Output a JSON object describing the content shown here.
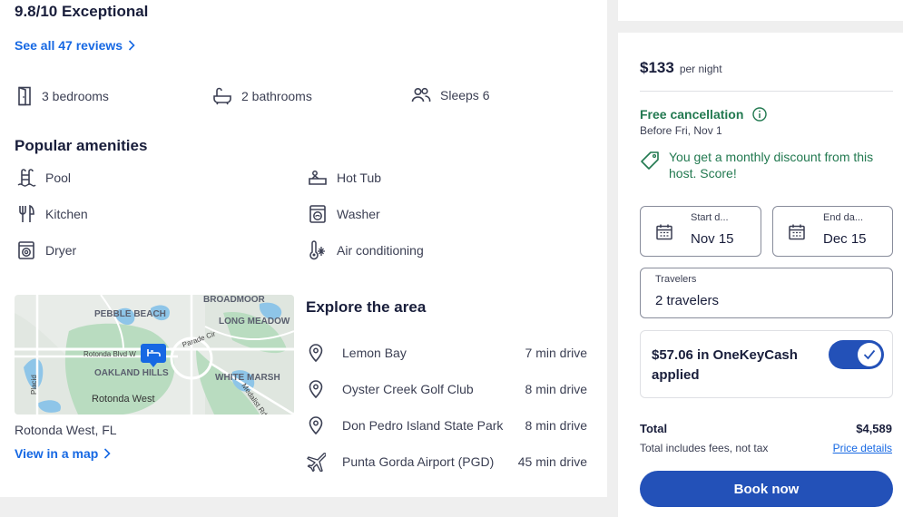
{
  "rating": {
    "text": "9.8/10 Exceptional",
    "reviews_link": "See all 47 reviews"
  },
  "facts": [
    {
      "icon": "door-icon",
      "label": "3 bedrooms"
    },
    {
      "icon": "bathtub-icon",
      "label": "2 bathrooms"
    },
    {
      "icon": "people-icon",
      "label": "Sleeps 6"
    }
  ],
  "amenities": {
    "title": "Popular amenities",
    "items": [
      {
        "icon": "pool-icon",
        "label": "Pool"
      },
      {
        "icon": "hot-tub-icon",
        "label": "Hot Tub"
      },
      {
        "icon": "kitchen-icon",
        "label": "Kitchen"
      },
      {
        "icon": "washer-icon",
        "label": "Washer"
      },
      {
        "icon": "dryer-icon",
        "label": "Dryer"
      },
      {
        "icon": "air-conditioning-icon",
        "label": "Air conditioning"
      }
    ]
  },
  "map": {
    "labels": [
      "BROADMOOR",
      "PEBBLE BEACH",
      "LONG MEADOW",
      "Rotonda Blvd W",
      "Parade Cir",
      "OAKLAND HILLS",
      "WHITE MARSH",
      "Rotonda West",
      "Medalist Rd",
      "Placid"
    ],
    "location": "Rotonda West, FL",
    "view_link": "View in a map"
  },
  "explore": {
    "title": "Explore the area",
    "items": [
      {
        "icon": "location-pin-icon",
        "name": "Lemon Bay",
        "distance": "7 min drive"
      },
      {
        "icon": "location-pin-icon",
        "name": "Oyster Creek Golf Club",
        "distance": "8 min drive"
      },
      {
        "icon": "location-pin-icon",
        "name": "Don Pedro Island State Park",
        "distance": "8 min drive"
      },
      {
        "icon": "airplane-icon",
        "name": "Punta Gorda Airport (PGD)",
        "distance": "45 min drive"
      }
    ]
  },
  "booking": {
    "price": "$133",
    "price_unit": "per night",
    "free_cancellation": "Free cancellation",
    "before_date": "Before Fri, Nov 1",
    "discount_text": "You get a monthly discount from this host. Score!",
    "start": {
      "label": "Start d...",
      "value": "Nov 15"
    },
    "end": {
      "label": "End da...",
      "value": "Dec 15"
    },
    "travelers": {
      "label": "Travelers",
      "value": "2 travelers"
    },
    "onekeycash": "$57.06 in OneKeyCash applied",
    "onekeycash_enabled": true,
    "total_label": "Total",
    "total_value": "$4,589",
    "total_sub": "Total includes fees, not tax",
    "price_details": "Price details",
    "book_button": "Book now"
  },
  "colors": {
    "accent_blue": "#1668e3",
    "button_blue": "#2351b8",
    "green": "#227950",
    "text": "#191e3b"
  }
}
